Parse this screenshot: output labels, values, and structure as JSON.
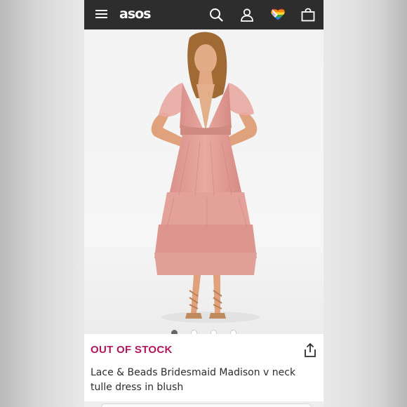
{
  "header": {
    "logo_text": "asos",
    "icons": [
      "menu-icon",
      "search-icon",
      "account-icon",
      "wishlist-icon",
      "bag-icon"
    ],
    "background": "#2d2d2d"
  },
  "gallery": {
    "image_count": 4,
    "active_index": 0
  },
  "product": {
    "stock_status": "OUT OF STOCK",
    "stock_color": "#b1185b",
    "title_line1": "Lace & Beads Bridesmaid Madison v neck",
    "title_line2": "tulle dress in blush",
    "share_icon": "share-icon"
  }
}
